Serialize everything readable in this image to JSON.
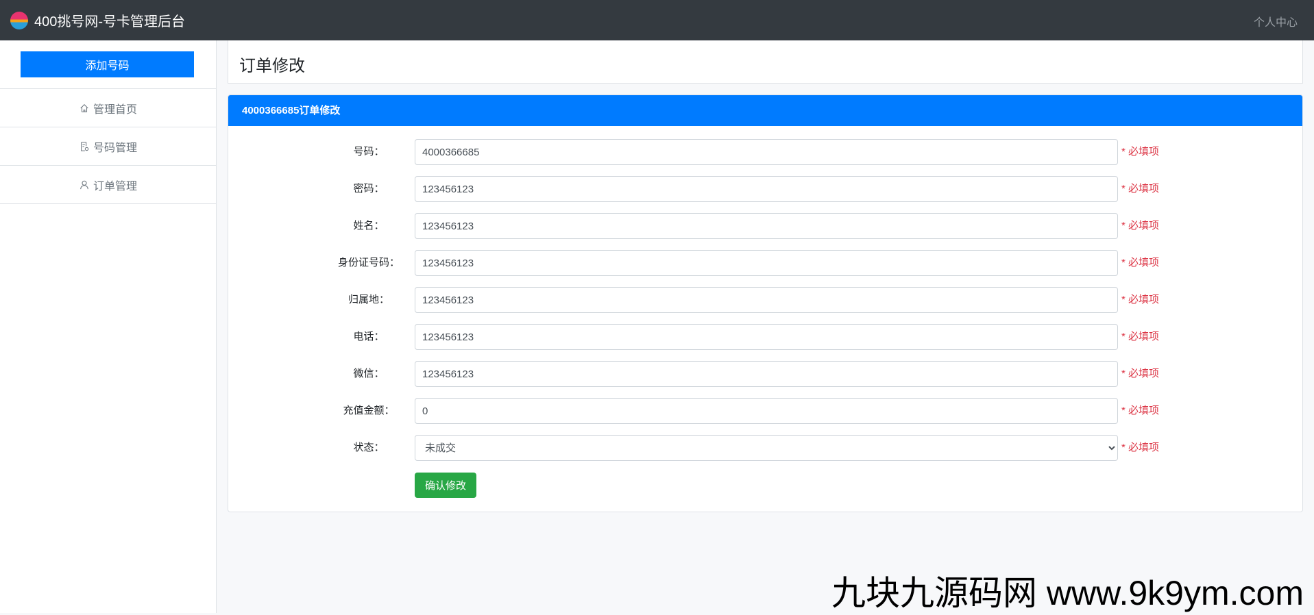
{
  "header": {
    "brand": "400挑号网-号卡管理后台",
    "user_menu": "个人中心"
  },
  "sidebar": {
    "add_button": "添加号码",
    "items": [
      {
        "label": "管理首页",
        "icon": "home-icon"
      },
      {
        "label": "号码管理",
        "icon": "document-icon"
      },
      {
        "label": "订单管理",
        "icon": "user-icon"
      }
    ]
  },
  "page": {
    "title": "订单修改"
  },
  "form": {
    "card_title": "4000366685订单修改",
    "fields": [
      {
        "label": "号码：",
        "value": "4000366685"
      },
      {
        "label": "密码：",
        "value": "123456123"
      },
      {
        "label": "姓名：",
        "value": "123456123"
      },
      {
        "label": "身份证号码：",
        "value": "123456123"
      },
      {
        "label": "归属地：",
        "value": "123456123"
      },
      {
        "label": "电话：",
        "value": "123456123"
      },
      {
        "label": "微信：",
        "value": "123456123"
      },
      {
        "label": "充值金额：",
        "value": "0"
      }
    ],
    "status": {
      "label": "状态：",
      "value": "未成交"
    },
    "required": "* 必填项",
    "submit": "确认修改"
  },
  "watermark": "九块九源码网 www.9k9ym.com"
}
